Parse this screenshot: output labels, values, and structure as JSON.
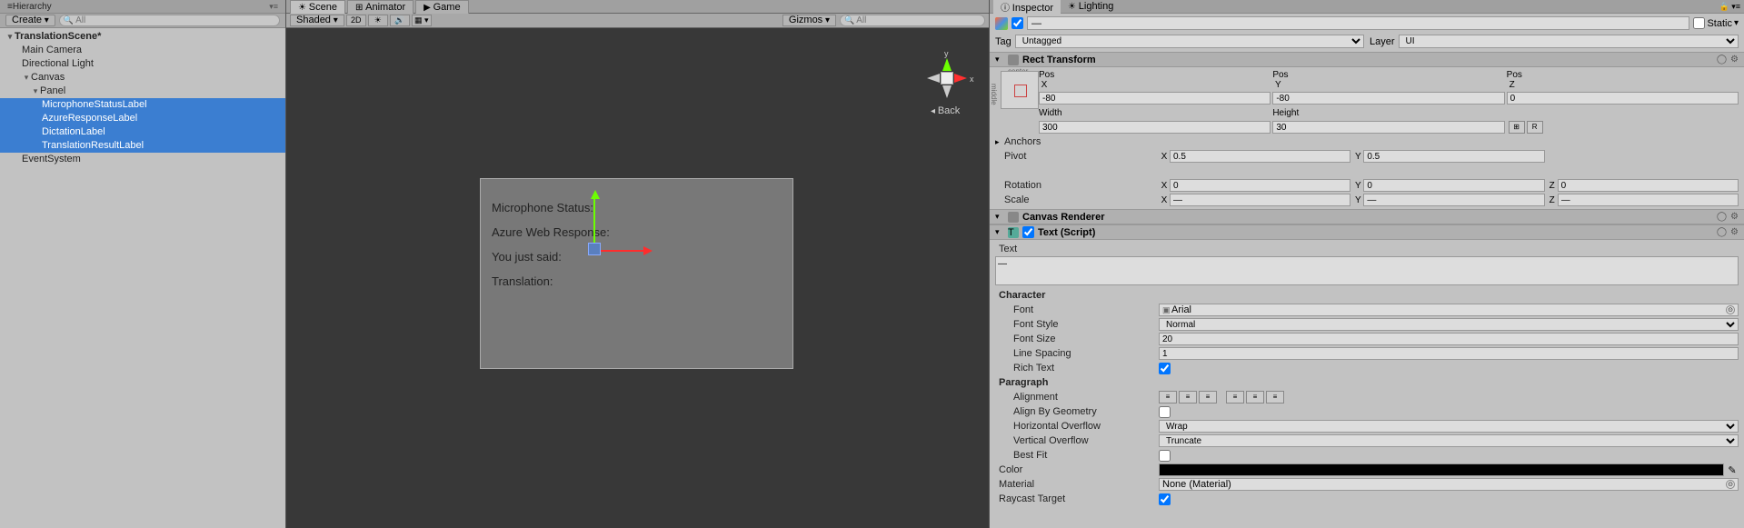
{
  "hierarchy": {
    "title": "Hierarchy",
    "create": "Create",
    "searchPlaceholder": "All",
    "root": "TranslationScene*",
    "items": [
      "Main Camera",
      "Directional Light",
      "Canvas",
      "Panel",
      "MicrophoneStatusLabel",
      "AzureResponseLabel",
      "DictationLabel",
      "TranslationResultLabel",
      "EventSystem"
    ]
  },
  "scene": {
    "tabs": [
      "Scene",
      "Animator",
      "Game"
    ],
    "shading": "Shaded",
    "mode2d": "2D",
    "gizmos": "Gizmos",
    "back": "Back",
    "yAxis": "y",
    "xAxis": "x",
    "canvasLabels": [
      "Microphone Status:",
      "Azure Web Response:",
      "You just said:",
      "Translation:"
    ]
  },
  "inspector": {
    "tabs": [
      "Inspector",
      "Lighting"
    ],
    "objectName": "—",
    "staticLabel": "Static",
    "tagLabel": "Tag",
    "tagValue": "Untagged",
    "layerLabel": "Layer",
    "layerValue": "UI",
    "rectTransform": {
      "title": "Rect Transform",
      "anchorCenter": "center",
      "anchorMiddle": "middle",
      "posX": "Pos X",
      "posXv": "-80",
      "posY": "Pos Y",
      "posYv": "-80",
      "posZ": "Pos Z",
      "posZv": "0",
      "width": "Width",
      "widthv": "300",
      "height": "Height",
      "heightv": "30",
      "anchors": "Anchors",
      "pivot": "Pivot",
      "pivotX": "0.5",
      "pivotY": "0.5",
      "rotation": "Rotation",
      "rotX": "0",
      "rotY": "0",
      "rotZ": "0",
      "scale": "Scale",
      "scaleX": "—",
      "scaleY": "—",
      "scaleZ": "—",
      "blueprint": "⊞",
      "rawEdit": "R"
    },
    "canvasRenderer": {
      "title": "Canvas Renderer"
    },
    "textComponent": {
      "title": "Text (Script)",
      "textLabel": "Text",
      "textValue": "—",
      "characterHeader": "Character",
      "font": "Font",
      "fontValue": "Arial",
      "fontStyle": "Font Style",
      "fontStyleValue": "Normal",
      "fontSize": "Font Size",
      "fontSizeValue": "20",
      "lineSpacing": "Line Spacing",
      "lineSpacingValue": "1",
      "richText": "Rich Text",
      "paragraphHeader": "Paragraph",
      "alignment": "Alignment",
      "alignByGeometry": "Align By Geometry",
      "hOverflow": "Horizontal Overflow",
      "hOverflowValue": "Wrap",
      "vOverflow": "Vertical Overflow",
      "vOverflowValue": "Truncate",
      "bestFit": "Best Fit",
      "color": "Color",
      "material": "Material",
      "materialValue": "None (Material)",
      "raycastTarget": "Raycast Target"
    }
  }
}
